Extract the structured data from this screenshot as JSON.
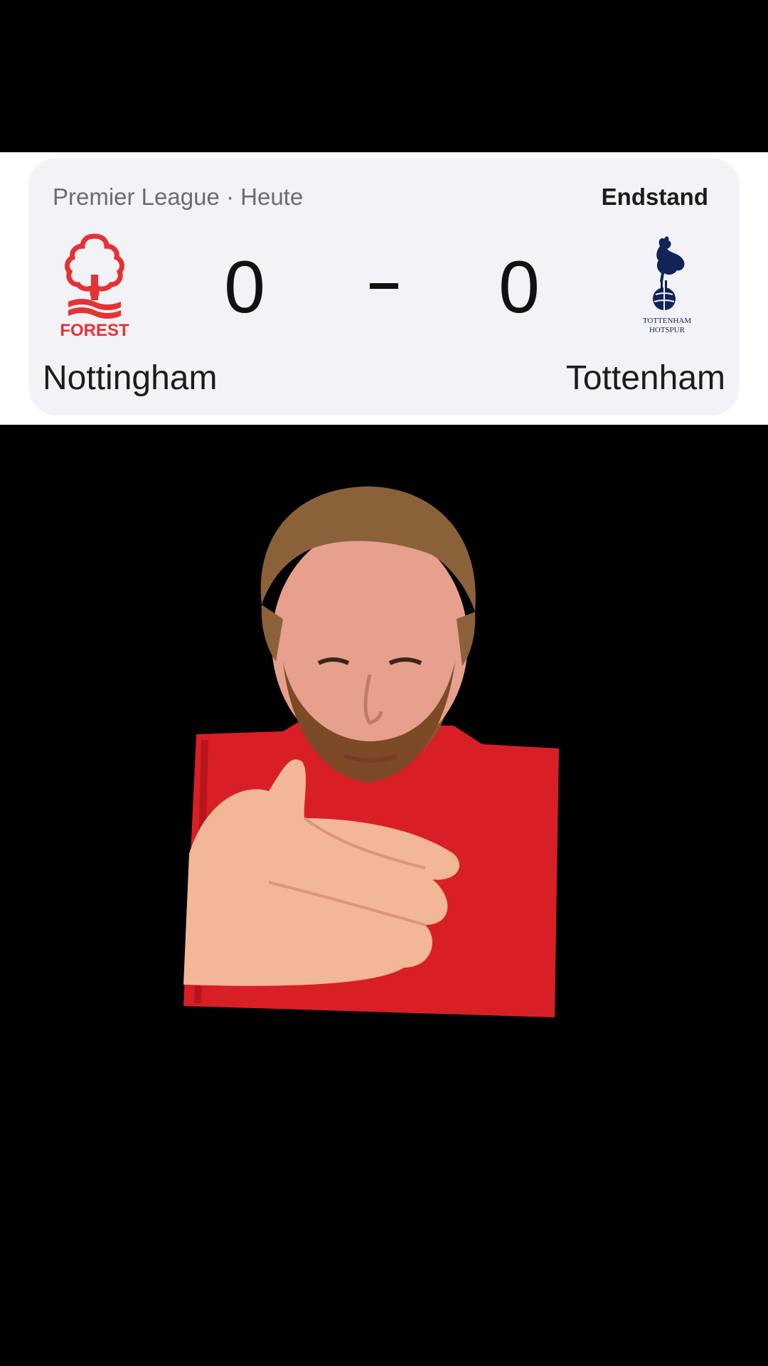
{
  "match": {
    "competition_label": "Premier League · Heute",
    "status": "Endstand",
    "home": {
      "name": "Nottingham",
      "score": "0",
      "crest_icon": "nottingham-forest-crest-icon",
      "crest_text": "FOREST",
      "color": "#e53233"
    },
    "away": {
      "name": "Tottenham",
      "score": "0",
      "crest_icon": "tottenham-hotspur-crest-icon",
      "crest_text_1": "TOTTENHAM",
      "crest_text_2": "HOTSPUR",
      "color": "#132257"
    },
    "separator": "-"
  },
  "colors": {
    "background": "#000000",
    "card": "#f2f2f7",
    "band": "#ffffff",
    "jersey": "#d81f26"
  }
}
